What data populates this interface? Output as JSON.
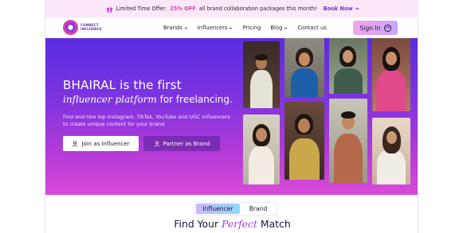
{
  "announcement": {
    "prefix": "Limited Time Offer:",
    "highlight": "25% OFF",
    "suffix": "all brand collaboration packages this month!",
    "cta": "Book Now →"
  },
  "logo": {
    "line1": "CONNECT",
    "line2": "INFLUENCE"
  },
  "nav": {
    "items": [
      {
        "label": "Brands",
        "has_dropdown": true
      },
      {
        "label": "Influencers",
        "has_dropdown": true
      },
      {
        "label": "Pricing",
        "has_dropdown": false
      },
      {
        "label": "Blog",
        "has_dropdown": true
      },
      {
        "label": "Contact us",
        "has_dropdown": false
      }
    ],
    "signin_label": "Sign In"
  },
  "hero": {
    "title": "BHAIRAL is the first",
    "subtitle_script": "influencer platform",
    "subtitle_rest": "for freelancing.",
    "description": "Find and hire top Instagram, TikTok, YouTube and UGC influencers to create unique content for your brand.",
    "join_label": "Join as Influencer",
    "partner_label": "Partner as Brand"
  },
  "toggle": {
    "option1": "Influencer",
    "option2": "Brand",
    "active": "Influencer"
  },
  "match": {
    "pre": "Find Your",
    "script": "Perfect",
    "post": "Match"
  },
  "colors": {
    "accent_purple": "#7c34e0",
    "accent_pink": "#d94bd8",
    "highlight_pink": "#d43fb0"
  }
}
